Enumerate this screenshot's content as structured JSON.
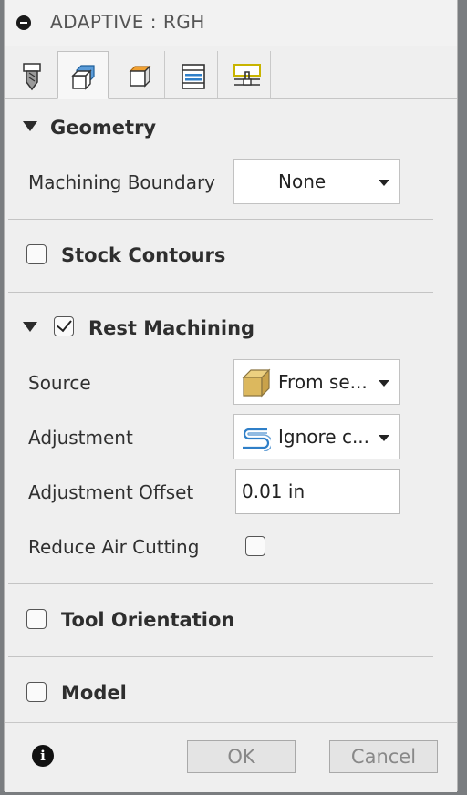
{
  "window": {
    "title": "ADAPTIVE : RGH"
  },
  "tabs": [
    {
      "icon": "tool-icon"
    },
    {
      "icon": "geometry-icon",
      "active": true
    },
    {
      "icon": "heights-icon"
    },
    {
      "icon": "passes-icon"
    },
    {
      "icon": "linking-icon"
    }
  ],
  "geometry": {
    "title": "Geometry",
    "machining_boundary_label": "Machining Boundary",
    "machining_boundary_value": "None"
  },
  "stock_contours": {
    "title": "Stock Contours",
    "checked": false
  },
  "rest_machining": {
    "title": "Rest Machining",
    "checked": true,
    "source_label": "Source",
    "source_value": "From se...",
    "adjustment_label": "Adjustment",
    "adjustment_value": "Ignore c...",
    "adjustment_offset_label": "Adjustment Offset",
    "adjustment_offset_value": "0.01 in",
    "reduce_air_cutting_label": "Reduce Air Cutting",
    "reduce_air_cutting_checked": false
  },
  "tool_orientation": {
    "title": "Tool Orientation",
    "checked": false
  },
  "model": {
    "title": "Model",
    "checked": false
  },
  "footer": {
    "ok_label": "OK",
    "cancel_label": "Cancel"
  },
  "colors": {
    "dialog_bg": "#efefef",
    "button_bg": "#e4e4e4",
    "accent_blue": "#2f7fc8"
  }
}
